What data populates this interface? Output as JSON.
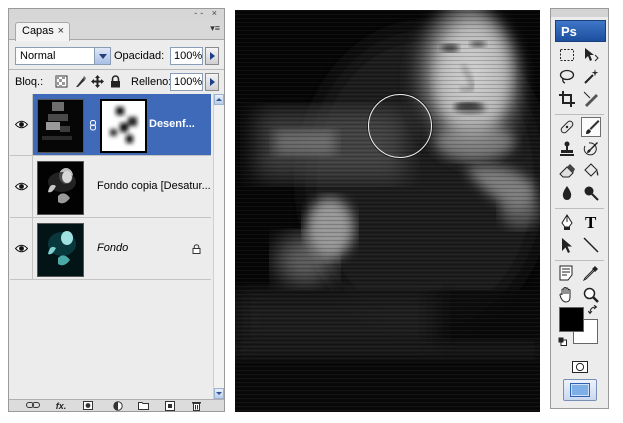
{
  "layers_panel": {
    "tab_label": "Capas",
    "tab_close": "×",
    "window_buttons": "-- ×",
    "panel_menu": "▾≡",
    "blend_mode": "Normal",
    "opacity_label": "Opacidad:",
    "opacity_value": "100%",
    "lock_label": "Bloq.:",
    "fill_label": "Relleno:",
    "fill_value": "100%",
    "layers": [
      {
        "name": "Desenf...",
        "selected": true,
        "visible": true,
        "has_mask": true
      },
      {
        "name": "Fondo copia [Desatur...",
        "selected": false,
        "visible": true,
        "has_mask": false
      },
      {
        "name": "Fondo",
        "selected": false,
        "visible": true,
        "locked": true,
        "italic": true
      }
    ],
    "bottom_icons": [
      "link-icon",
      "fx-icon",
      "mask-icon",
      "adjustment-icon",
      "group-icon",
      "new-layer-icon",
      "trash-icon"
    ],
    "fx_label": "fx."
  },
  "canvas": {
    "cursor": "brush-circle"
  },
  "tools_panel": {
    "logo": "Ps",
    "tools": [
      "marquee-icon",
      "move-icon",
      "lasso-icon",
      "magic-wand-icon",
      "crop-icon",
      "slice-icon",
      "healing-brush-icon",
      "brush-icon",
      "clone-stamp-icon",
      "history-brush-icon",
      "eraser-icon",
      "paint-bucket-icon",
      "blur-icon",
      "dodge-icon",
      "pen-icon",
      "type-icon",
      "path-selection-icon",
      "line-icon",
      "notes-icon",
      "eyedropper-icon",
      "hand-icon",
      "zoom-icon"
    ],
    "active_tool": "brush-icon",
    "type_tool_glyph": "T",
    "foreground_color": "#000000",
    "background_color": "#ffffff"
  }
}
